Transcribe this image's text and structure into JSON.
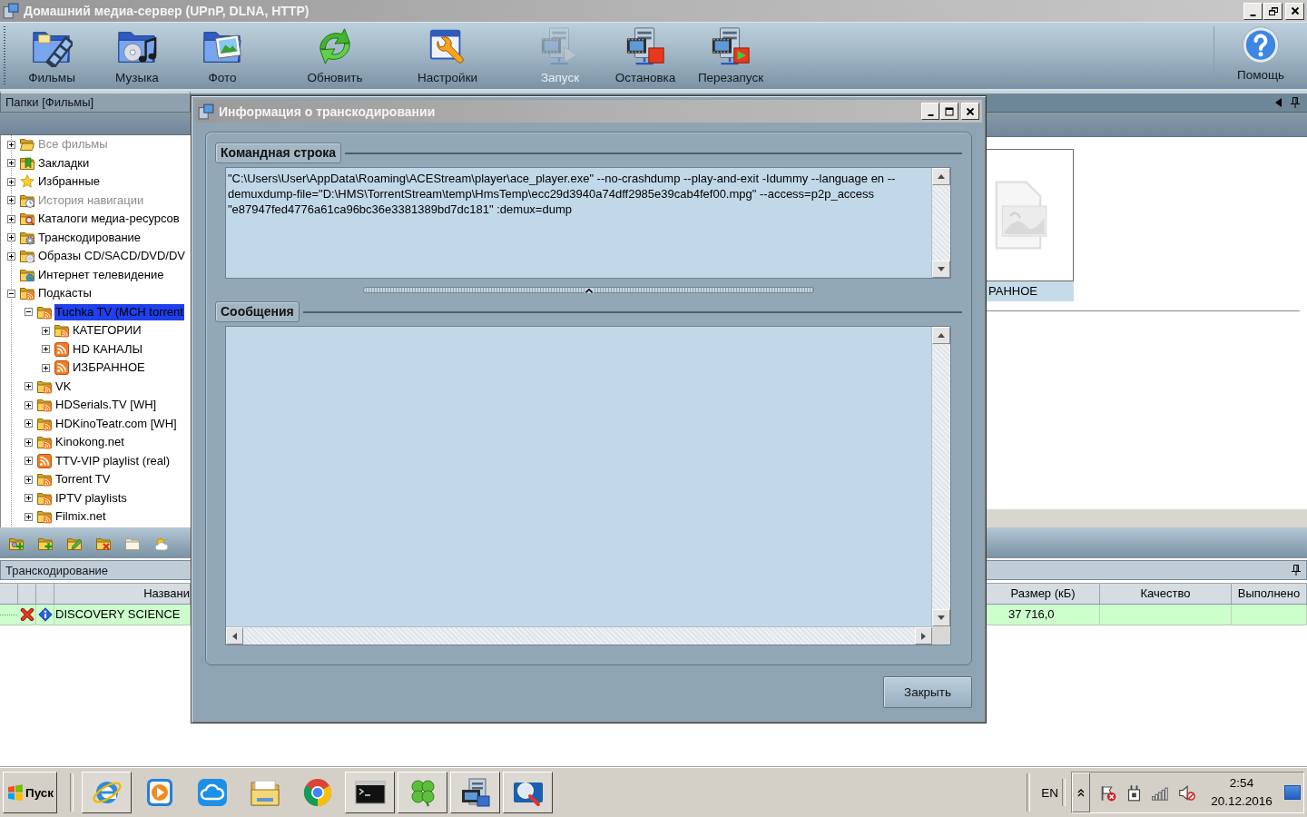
{
  "window": {
    "title": "Домашний медиа-сервер (UPnP, DLNA, HTTP)"
  },
  "toolbar": {
    "groups": [
      [
        {
          "kind": "movies",
          "label": "Фильмы",
          "disabled": false
        },
        {
          "kind": "music",
          "label": "Музыка",
          "disabled": false
        },
        {
          "kind": "photo",
          "label": "Фото",
          "disabled": false
        }
      ],
      [
        {
          "kind": "refresh",
          "label": "Обновить",
          "disabled": false
        },
        {
          "kind": "settings",
          "label": "Настройки",
          "disabled": false
        }
      ],
      [
        {
          "kind": "start",
          "label": "Запуск",
          "disabled": true
        },
        {
          "kind": "stop",
          "label": "Остановка",
          "disabled": false
        },
        {
          "kind": "restart",
          "label": "Перезапуск",
          "disabled": false
        }
      ]
    ],
    "help": {
      "kind": "help",
      "label": "Помощь",
      "disabled": false
    }
  },
  "folders_panel": {
    "title": "Папки [Фильмы]",
    "tree": [
      {
        "label": "Все фильмы",
        "kind": "all",
        "expanded": false,
        "selected": false,
        "disabled": true
      },
      {
        "label": "Закладки",
        "kind": "bookmarks",
        "expanded": false,
        "selected": false,
        "disabled": false
      },
      {
        "label": "Избранные",
        "kind": "favorites",
        "expanded": false,
        "selected": false,
        "disabled": false
      },
      {
        "label": "История навигации",
        "kind": "history",
        "expanded": false,
        "selected": false,
        "disabled": true
      },
      {
        "label": "Каталоги медиа-ресурсов",
        "kind": "catalogs",
        "expanded": false,
        "selected": false,
        "disabled": false
      },
      {
        "label": "Транскодирование",
        "kind": "transcoding",
        "expanded": false,
        "selected": false,
        "disabled": false
      },
      {
        "label": "Образы CD/SACD/DVD/DV",
        "kind": "disc_images",
        "expanded": false,
        "selected": false,
        "disabled": false
      },
      {
        "label": "Интернет телевидение",
        "kind": "internet_tv",
        "selected": false,
        "disabled": false
      },
      {
        "label": "Подкасты",
        "kind": "podcast",
        "expanded": true,
        "selected": false,
        "disabled": false,
        "children": [
          {
            "label": "Tuchka TV (MCH torrent",
            "kind": "podcast",
            "expanded": true,
            "selected": true,
            "disabled": false,
            "children": [
              {
                "label": "КАТЕГОРИИ",
                "kind": "podcast",
                "expanded": false,
                "selected": false,
                "disabled": false
              },
              {
                "label": "HD КАНАЛЫ",
                "kind": "feed",
                "expanded": false,
                "selected": false,
                "disabled": false
              },
              {
                "label": "ИЗБРАННОЕ",
                "kind": "feed",
                "expanded": false,
                "selected": false,
                "disabled": false
              }
            ]
          },
          {
            "label": "VK",
            "kind": "podcast",
            "expanded": false,
            "selected": false,
            "disabled": false
          },
          {
            "label": "HDSerials.TV [WH]",
            "kind": "podcast",
            "expanded": false,
            "selected": false,
            "disabled": false
          },
          {
            "label": "HDKinoTeatr.com [WH]",
            "kind": "podcast",
            "expanded": false,
            "selected": false,
            "disabled": false
          },
          {
            "label": "Kinokong.net",
            "kind": "podcast",
            "expanded": false,
            "selected": false,
            "disabled": false
          },
          {
            "label": "TTV-VIP playlist (real)",
            "kind": "feed",
            "expanded": false,
            "selected": false,
            "disabled": false
          },
          {
            "label": "Torrent TV",
            "kind": "podcast",
            "expanded": false,
            "selected": false,
            "disabled": false
          },
          {
            "label": "IPTV playlists",
            "kind": "podcast",
            "expanded": false,
            "selected": false,
            "disabled": false
          },
          {
            "label": "Filmix.net",
            "kind": "podcast",
            "expanded": false,
            "selected": false,
            "disabled": false
          }
        ]
      }
    ]
  },
  "media_panel": {
    "items": [
      {
        "caption": "РАННОЕ",
        "selected": true
      }
    ]
  },
  "transcoding_panel": {
    "title": "Транскодирование",
    "columns": [
      "Названи",
      "Размер (кБ)",
      "Качество",
      "Выполнено"
    ],
    "rows": [
      {
        "name": "DISCOVERY SCIENCE",
        "size": "37 716,0",
        "color": "#ccffcc"
      }
    ]
  },
  "dialog": {
    "title": "Информация о транскодировании",
    "command_group": "Командная строка",
    "command_line": "\"C:\\Users\\User\\AppData\\Roaming\\ACEStream\\player\\ace_player.exe\" --no-crashdump --play-and-exit -Idummy --language en --demuxdump-file=\"D:\\HMS\\TorrentStream\\temp\\HmsTemp\\ecc29d3940a74dff2985e39cab4fef00.mpg\" --access=p2p_access \"e87947fed4776a61ca96bc36e3381389bd7dc181\" :demux=dump",
    "messages_group": "Сообщения",
    "close_button": "Закрыть"
  },
  "taskbar": {
    "start_button": "Пуск",
    "apps": [
      {
        "kind": "ie",
        "running": true
      },
      {
        "kind": "player",
        "running": false
      },
      {
        "kind": "cloud",
        "running": false
      },
      {
        "kind": "explorer",
        "running": false
      },
      {
        "kind": "chrome",
        "running": false
      },
      {
        "kind": "console",
        "running": true
      },
      {
        "kind": "clover",
        "running": true
      },
      {
        "kind": "media_server",
        "running": true
      },
      {
        "kind": "disk_tool",
        "running": true
      }
    ],
    "language": "EN",
    "time": "2:54",
    "date": "20.12.2016"
  }
}
